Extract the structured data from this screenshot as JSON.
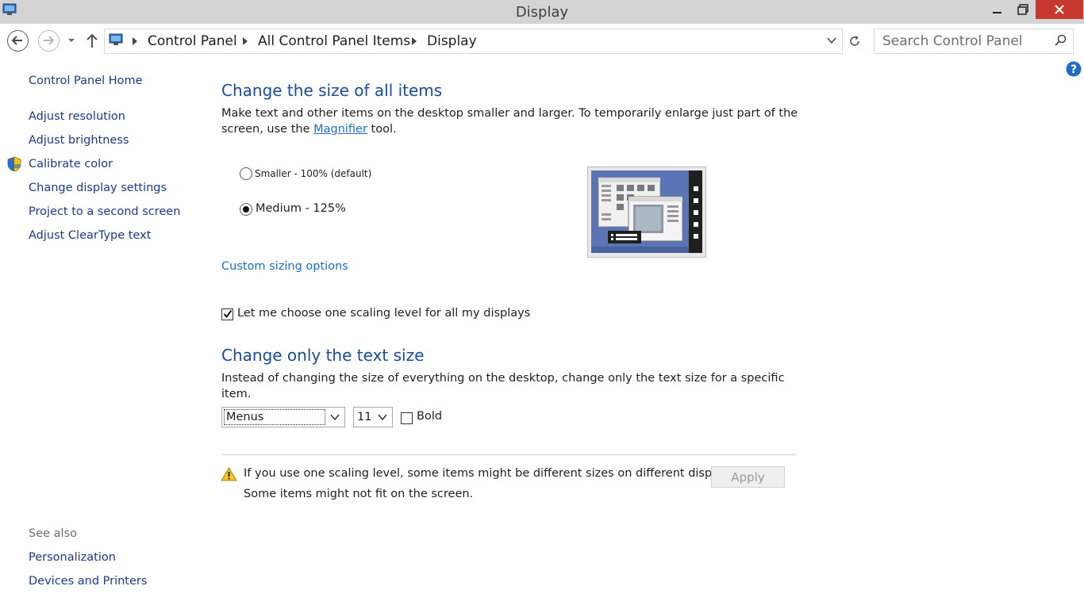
{
  "window": {
    "title": "Display"
  },
  "nav": {
    "breadcrumbs": [
      "Control Panel",
      "All Control Panel Items",
      "Display"
    ],
    "search_placeholder": "Search Control Panel"
  },
  "left_pane": {
    "home_link": "Control Panel Home",
    "links": [
      "Adjust resolution",
      "Adjust brightness",
      "Calibrate color",
      "Change display settings",
      "Project to a second screen",
      "Adjust ClearType text"
    ],
    "see_also_heading": "See also",
    "see_also_links": [
      "Personalization",
      "Devices and Printers"
    ]
  },
  "main": {
    "size_heading": "Change the size of all items",
    "size_desc_part1": "Make text and other items on the desktop smaller and larger. To temporarily enlarge just part of the screen, use the ",
    "magnifier_link": "Magnifier",
    "size_desc_part2": " tool.",
    "radio_options": [
      {
        "label": "Smaller - 100% (default)",
        "selected": false
      },
      {
        "label": "Medium - 125%",
        "selected": true
      }
    ],
    "custom_sizing_link": "Custom sizing options",
    "one_scaling_checkbox": {
      "label": "Let me choose one scaling level for all my displays",
      "checked": true
    },
    "text_heading": "Change only the text size",
    "text_desc": "Instead of changing the size of everything on the desktop, change only the text size for a specific item.",
    "item_select_value": "Menus",
    "size_select_value": "11",
    "bold_checkbox": {
      "label": "Bold",
      "checked": false
    },
    "warning_line1": "If you use one scaling level, some items might be different sizes on different displays.",
    "warning_line2": "Some items might not fit on the screen.",
    "apply_label": "Apply"
  },
  "icons": {
    "app": "display-control-panel-icon",
    "help": "help-icon",
    "shield": "uac-shield-icon",
    "warning": "warning-icon"
  },
  "colors": {
    "heading_blue": "#1b4a9a",
    "link_blue": "#1a6ec2",
    "close_red": "#c7392f",
    "preview_blue": "#5a74b6"
  }
}
